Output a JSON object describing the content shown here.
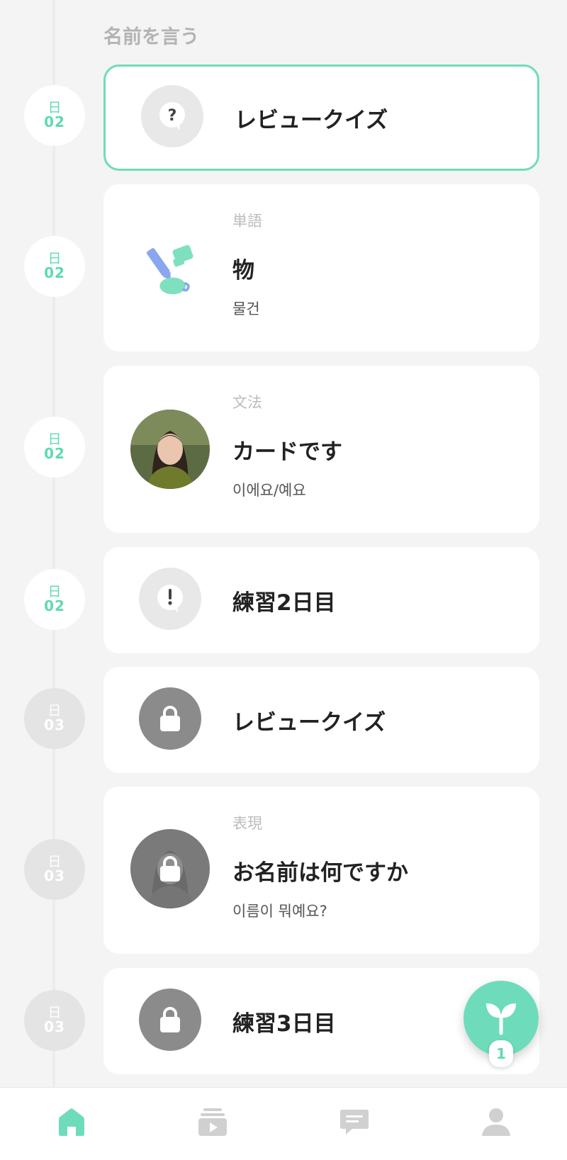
{
  "section": {
    "title": "名前を言う"
  },
  "accent_color": "#6edcbb",
  "timeline": [
    {
      "day_label": "日",
      "day_number": "02",
      "state": "active"
    },
    {
      "day_label": "日",
      "day_number": "02",
      "state": "active"
    },
    {
      "day_label": "日",
      "day_number": "02",
      "state": "active"
    },
    {
      "day_label": "日",
      "day_number": "02",
      "state": "active"
    },
    {
      "day_label": "日",
      "day_number": "03",
      "state": "locked"
    },
    {
      "day_label": "日",
      "day_number": "03",
      "state": "locked"
    },
    {
      "day_label": "日",
      "day_number": "03",
      "state": "locked"
    }
  ],
  "cards": [
    {
      "title": "レビュークイズ",
      "icon": "question-bubble-icon",
      "selected": true
    },
    {
      "category": "単語",
      "title": "物",
      "subtitle": "물건",
      "icon": "stationery-illustration-icon"
    },
    {
      "category": "文法",
      "title": "カードです",
      "subtitle": "이에요/예요",
      "icon": "teacher-avatar"
    },
    {
      "title": "練習2日目",
      "icon": "exclamation-bubble-icon"
    },
    {
      "title": "レビュークイズ",
      "icon": "lock-icon",
      "locked": true
    },
    {
      "category": "表現",
      "title": "お名前は何ですか",
      "subtitle": "이름이 뭐예요?",
      "icon": "lock-icon",
      "locked": true
    },
    {
      "title": "練習3日目",
      "icon": "lock-icon",
      "locked": true
    }
  ],
  "fab": {
    "icon": "sprout-icon",
    "count": "1"
  },
  "bottom_nav": [
    {
      "icon": "home-icon",
      "active": true
    },
    {
      "icon": "video-playlist-icon",
      "active": false
    },
    {
      "icon": "chat-icon",
      "active": false
    },
    {
      "icon": "profile-icon",
      "active": false
    }
  ]
}
